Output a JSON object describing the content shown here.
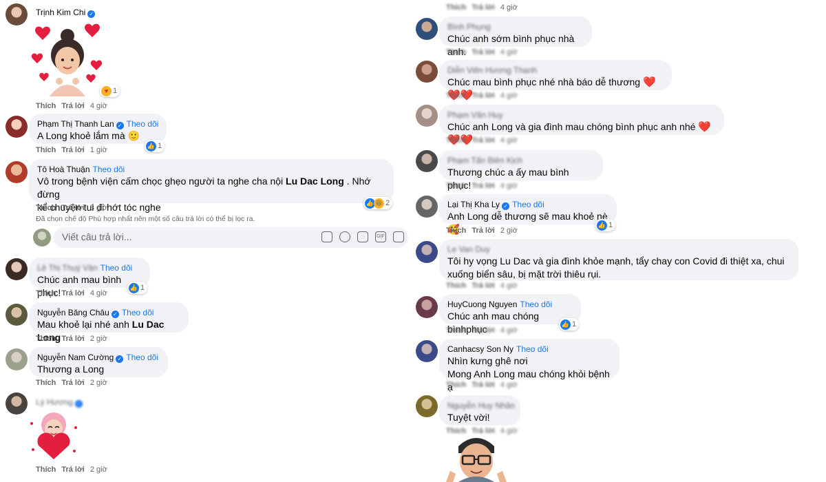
{
  "labels": {
    "like": "Thích",
    "reply": "Trả lời",
    "follow": "Theo dõi"
  },
  "left": {
    "comments": [
      {
        "author": "Trịnh Kim Chi",
        "time": "4 giờ",
        "reaction_count": "1"
      },
      {
        "author": "Phạm Thị Thanh Lan",
        "text": "A Long khoẻ lắm mà 🙂",
        "time": "1 giờ",
        "reaction_count": "1"
      },
      {
        "author": "Tô Hoà Thuận",
        "text_line1": "Vô trong bệnh viện cấm chọc ghẹo người ta nghe cha nội ",
        "text_bold": "Lu Dac Long",
        "text_line1_end": " . Nhớ đừng",
        "text_line2": "kể chuyện tui đi hớt tóc nghe",
        "time": "3 giờ",
        "reaction_count": "2"
      },
      {
        "author": "Lê Thị Thuý Vân",
        "text": "Chúc anh mau bình phục!",
        "time": "4 giờ",
        "reaction_count": "1"
      },
      {
        "author": "Nguyễn Băng Châu",
        "text": "Mau khoẻ lại nhé anh ",
        "text_bold": "Lu Dac Long",
        "time": "2 giờ"
      },
      {
        "author": "Nguyễn Nam Cường",
        "text": "Thương a Long",
        "time": "2 giờ"
      },
      {
        "author": "Lý Hương",
        "time": "2 giờ"
      }
    ],
    "filter_note": "Đã chọn chế độ Phù hợp nhất nên một số câu trả lời có thể bị lọc ra.",
    "reply_placeholder": "Viết câu trả lời..."
  },
  "right": {
    "top_time": "4 giờ",
    "comments": [
      {
        "author": "Bình Phụng",
        "text": "Chúc anh sớm bình phục nhà anh.",
        "time": "4 giờ"
      },
      {
        "author": "Diễn Viên Hương Thanh",
        "text": "Chúc mau bình phục nhé nhà báo dễ thương ",
        "hearts": "❤️❤️❤️",
        "time": "4 giờ"
      },
      {
        "author": "Phạm Văn Huy",
        "text": "Chúc anh Long và gia đình mau chóng bình phục anh nhé ",
        "hearts": "❤️❤️❤️",
        "time": "4 giờ"
      },
      {
        "author": "Phạm Tấn Biên Kịch",
        "text": "Thương chúc a ấy mau bình phục!",
        "time": "4 giờ"
      },
      {
        "author": "Lại Thị Kha Ly",
        "text": "Anh Long dễ thương sẽ mau khoẻ nè 🥰",
        "time": "2 giờ",
        "reaction_count": "1"
      },
      {
        "author": "Le Van Duy",
        "text_line1": "Tôi hy vọng Lu Dac và gia đình khỏe mạnh, tẩy chay con Covid đi thiệt xa, chui",
        "text_line2": "xuống biển sâu, bị mặt trời thiêu rụi.",
        "time": "4 giờ"
      },
      {
        "author": "HuyCuong Nguyen",
        "text": "Chúc anh mau chóng bìnhphục",
        "time": "4 giờ",
        "reaction_count": "1"
      },
      {
        "author": "Canhacsy Son Ny",
        "text_line1": "Nhìn kưng ghê nơi",
        "text_line2": "Mong Anh Long mau chóng khỏi bệnh ạ",
        "time": "4 giờ"
      },
      {
        "author": "Nguyễn Huy Nhân",
        "text": "Tuyệt vời!",
        "time": "4 giờ"
      }
    ]
  },
  "icons": [
    "verified-icon",
    "like-reaction-icon",
    "haha-reaction-icon",
    "love-reaction-icon",
    "sticker-icon",
    "emoji-icon",
    "camera-icon",
    "gif-icon",
    "avatar-sticker-icon"
  ],
  "colors": {
    "link": "#1877f2",
    "bubble": "#f0f2f5",
    "meta": "#65676b",
    "heart": "#e41e3f"
  }
}
